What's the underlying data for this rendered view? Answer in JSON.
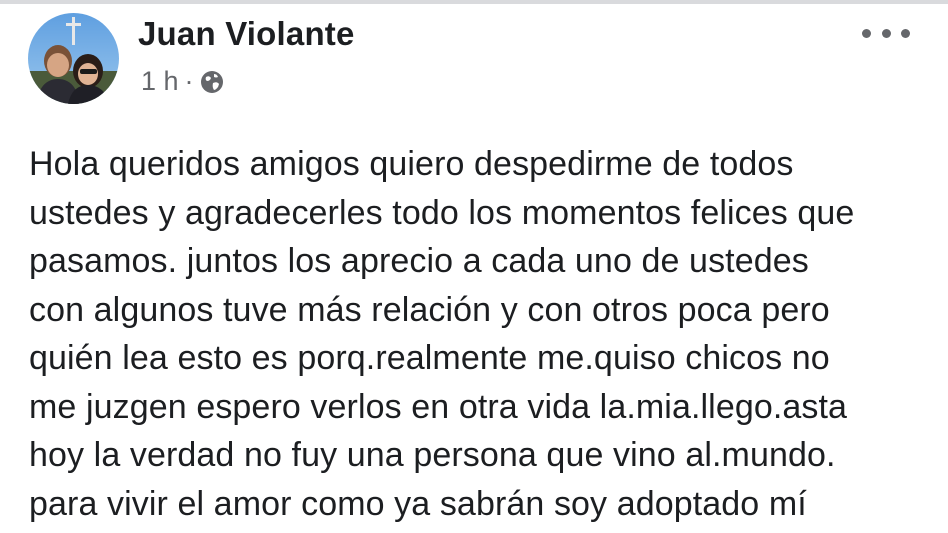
{
  "post": {
    "author": "Juan Violante",
    "time": "1 h",
    "separator": "·",
    "audience_icon": "globe-icon",
    "more_icon": "more-options-icon",
    "text": "Hola queridos amigos quiero despedirme de todos\nustedes y agradecerles todo los momentos felices que\npasamos. juntos los aprecio a cada uno de ustedes\ncon algunos tuve más relación y con otros poca pero\nquién lea esto es porq.realmente me.quiso chicos no\nme juzgen espero verlos en otra vida la.mia.llego.asta\nhoy la verdad no fuy una persona que vino al.mundo.\npara vivir el amor como ya sabrán soy adoptado mí"
  },
  "colors": {
    "text": "#1c1e21",
    "secondary": "#65676b",
    "divider": "#d9dadd"
  }
}
